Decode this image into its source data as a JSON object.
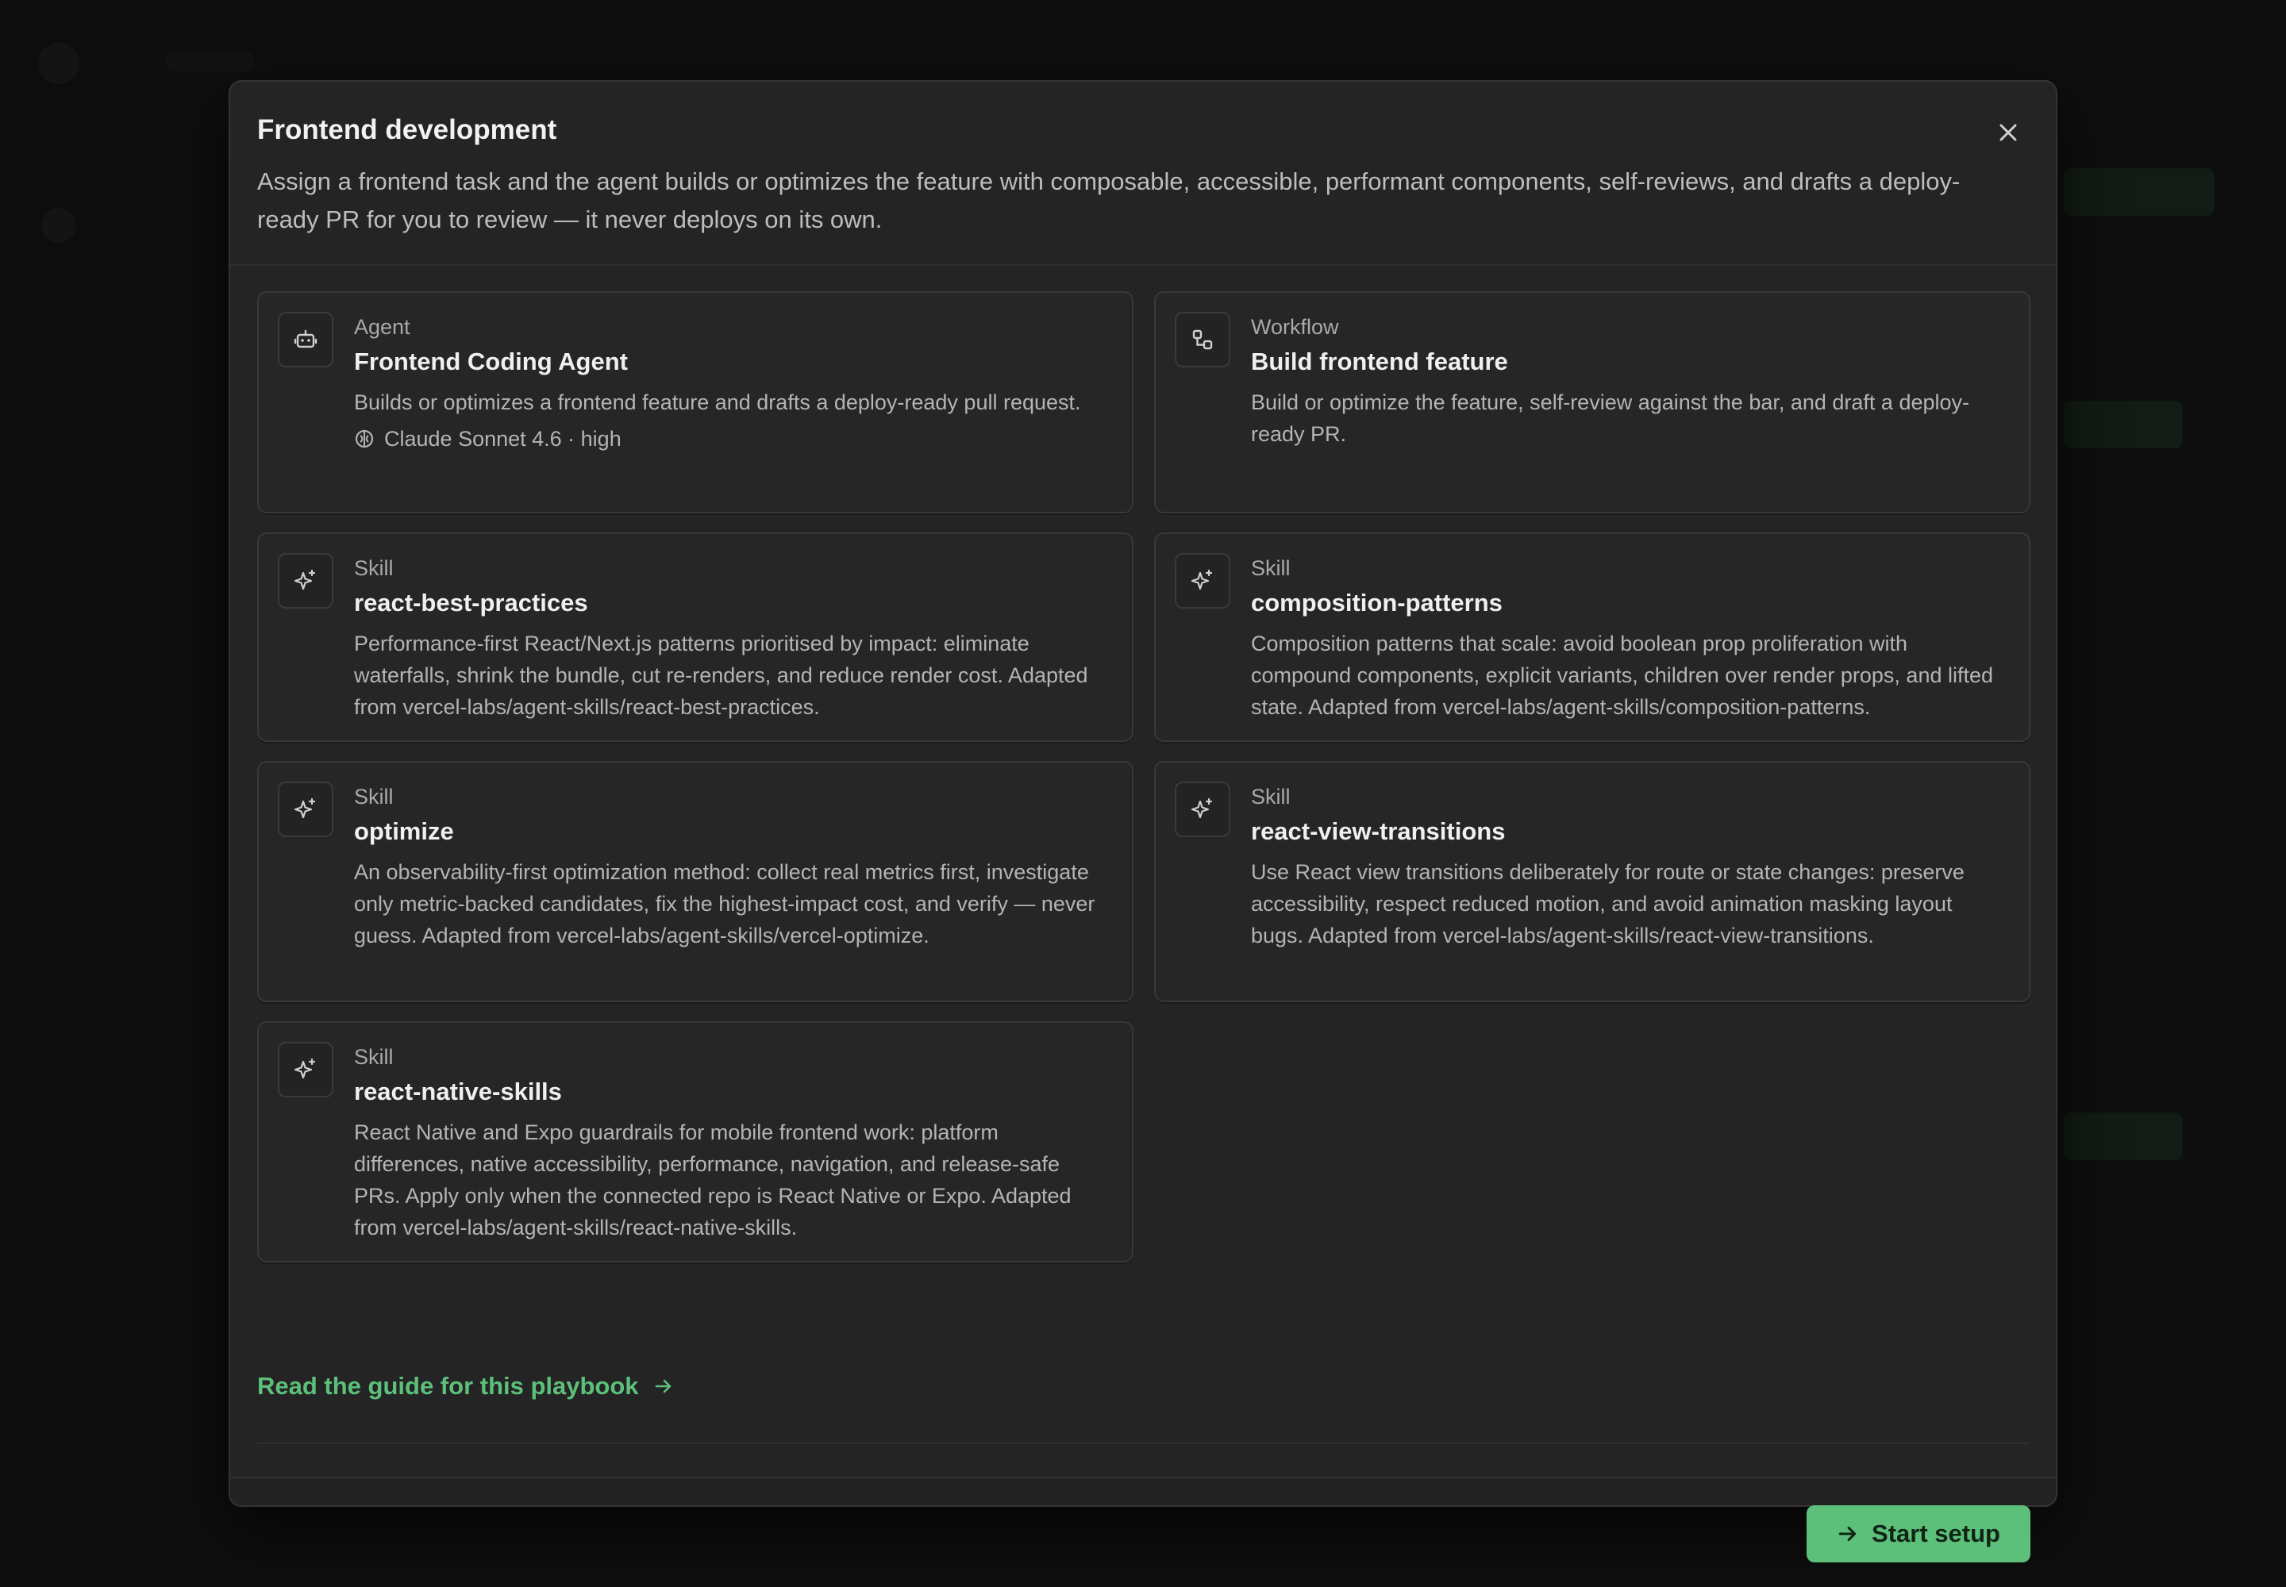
{
  "modal": {
    "title": "Frontend development",
    "description": "Assign a frontend task and the agent builds or optimizes the feature with composable, accessible, performant components, self-reviews, and drafts a deploy-ready PR for you to review — it never deploys on its own.",
    "close_icon": "close-icon"
  },
  "cards": [
    {
      "kind": "Agent",
      "title": "Frontend Coding Agent",
      "description": "Builds or optimizes a frontend feature and drafts a deploy-ready pull request.",
      "meta": "Claude Sonnet 4.6 · high",
      "icon": "robot-icon"
    },
    {
      "kind": "Workflow",
      "title": "Build frontend feature",
      "description": "Build or optimize the feature, self-review against the bar, and draft a deploy-ready PR.",
      "icon": "workflow-icon"
    },
    {
      "kind": "Skill",
      "title": "react-best-practices",
      "description": "Performance-first React/Next.js patterns prioritised by impact: eliminate waterfalls, shrink the bundle, cut re-renders, and reduce render cost. Adapted from vercel-labs/agent-skills/react-best-practices.",
      "icon": "sparkle-icon"
    },
    {
      "kind": "Skill",
      "title": "composition-patterns",
      "description": "Composition patterns that scale: avoid boolean prop proliferation with compound components, explicit variants, children over render props, and lifted state. Adapted from vercel-labs/agent-skills/composition-patterns.",
      "icon": "sparkle-icon"
    },
    {
      "kind": "Skill",
      "title": "optimize",
      "description": "An observability-first optimization method: collect real metrics first, investigate only metric-backed candidates, fix the highest-impact cost, and verify — never guess. Adapted from vercel-labs/agent-skills/vercel-optimize.",
      "icon": "sparkle-icon"
    },
    {
      "kind": "Skill",
      "title": "react-view-transitions",
      "description": "Use React view transitions deliberately for route or state changes: preserve accessibility, respect reduced motion, and avoid animation masking layout bugs. Adapted from vercel-labs/agent-skills/react-view-transitions.",
      "icon": "sparkle-icon"
    },
    {
      "kind": "Skill",
      "title": "react-native-skills",
      "description": "React Native and Expo guardrails for mobile frontend work: platform differences, native accessibility, performance, navigation, and release-safe PRs. Apply only when the connected repo is React Native or Expo. Adapted from vercel-labs/agent-skills/react-native-skills.",
      "icon": "sparkle-icon"
    }
  ],
  "guide_link": {
    "label": "Read the guide for this playbook",
    "icon": "arrow-right-icon"
  },
  "footer": {
    "start_label": "Start setup",
    "start_icon": "arrow-right-icon"
  },
  "colors": {
    "accent": "#5cc07a",
    "modal_bg": "#242424",
    "card_bg": "#262626"
  }
}
